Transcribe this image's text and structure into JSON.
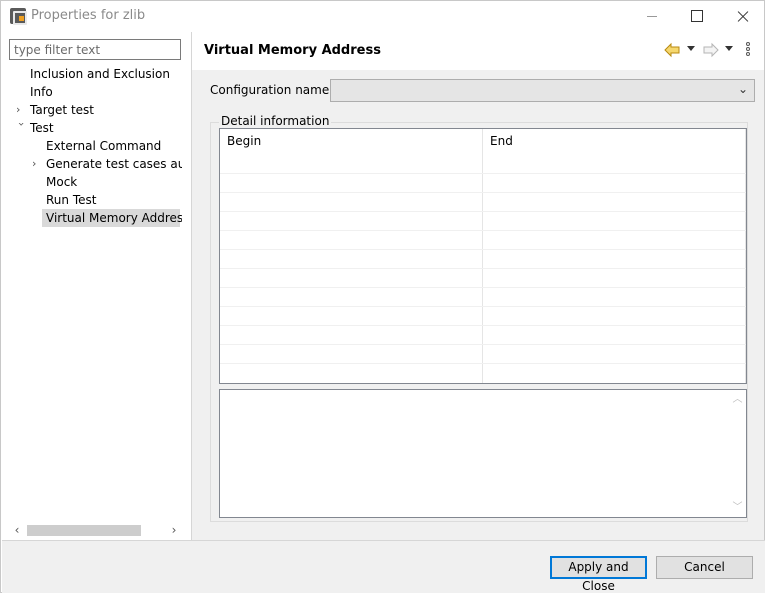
{
  "window": {
    "title": "Properties for zlib"
  },
  "filter": {
    "placeholder": "type filter text"
  },
  "tree": {
    "items": [
      {
        "label": "Inclusion and Exclusion"
      },
      {
        "label": "Info"
      },
      {
        "label": "Target test"
      },
      {
        "label": "Test"
      },
      {
        "label": "External Command"
      },
      {
        "label": "Generate test cases autor"
      },
      {
        "label": "Mock"
      },
      {
        "label": "Run Test"
      },
      {
        "label": "Virtual Memory Address"
      }
    ]
  },
  "page": {
    "title": "Virtual Memory Address",
    "config_label": "Configuration name:",
    "config_value": "",
    "group_label": "Detail information",
    "table": {
      "columns": [
        "Begin",
        "End"
      ],
      "rows": []
    }
  },
  "buttons": {
    "apply": "Apply and Close",
    "cancel": "Cancel"
  },
  "icons": [
    "back-arrow-icon",
    "forward-arrow-icon",
    "view-menu-icon",
    "minimize-icon",
    "maximize-icon",
    "close-icon",
    "app-icon"
  ],
  "colors": {
    "accent": "#0078d7",
    "selection": "#d9d9d9",
    "back_arrow": "#e8b838"
  }
}
